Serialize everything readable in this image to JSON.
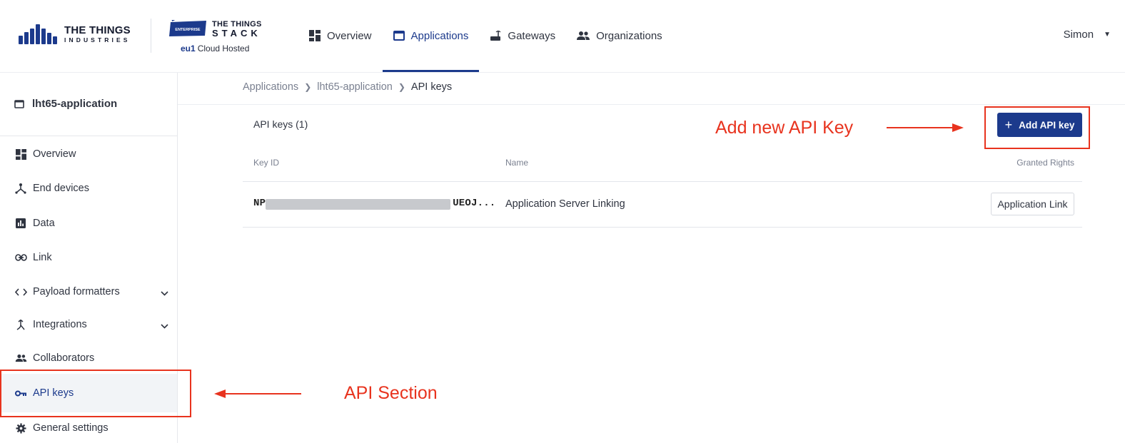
{
  "header": {
    "tti_logo": {
      "line1": "THE THINGS",
      "line2": "INDUSTRIES"
    },
    "tts_logo": {
      "badge": "ENTERPRISE",
      "line1": "THE THINGS",
      "line2": "STACK",
      "region": "eu1",
      "hosting": "Cloud Hosted"
    },
    "nav": [
      {
        "label": "Overview",
        "icon": "dashboard-icon",
        "active": false
      },
      {
        "label": "Applications",
        "icon": "application-icon",
        "active": true
      },
      {
        "label": "Gateways",
        "icon": "gateway-icon",
        "active": false
      },
      {
        "label": "Organizations",
        "icon": "people-icon",
        "active": false
      }
    ],
    "user": {
      "name": "Simon",
      "icon": "caret-down-icon"
    }
  },
  "sidebar": {
    "title": "lht65-application",
    "items": [
      {
        "label": "Overview",
        "icon": "dashboard-icon"
      },
      {
        "label": "End devices",
        "icon": "device-hub-icon"
      },
      {
        "label": "Data",
        "icon": "bar-chart-icon"
      },
      {
        "label": "Link",
        "icon": "link-icon"
      },
      {
        "label": "Payload formatters",
        "icon": "code-icon",
        "expandable": true
      },
      {
        "label": "Integrations",
        "icon": "merge-icon",
        "expandable": true
      },
      {
        "label": "Collaborators",
        "icon": "people-icon"
      },
      {
        "label": "API keys",
        "icon": "key-icon",
        "active": true
      },
      {
        "label": "General settings",
        "icon": "gear-icon"
      }
    ]
  },
  "breadcrumb": [
    "Applications",
    "lht65-application",
    "API keys"
  ],
  "api_keys": {
    "count_label": "API keys (1)",
    "add_button": "Add API key",
    "columns": {
      "key_id": "Key ID",
      "name": "Name",
      "rights": "Granted Rights"
    },
    "rows": [
      {
        "key_id": "NP…UEOJ...",
        "key_prefix": "NP",
        "key_suffix": "UEOJ...",
        "name": "Application Server Linking",
        "rights": "Application Link"
      }
    ]
  },
  "annotations": {
    "add_key": "Add new API Key",
    "api_section": "API Section",
    "color": "#e8331e"
  },
  "colors": {
    "accent": "#1c3a8c",
    "annotation": "#e8331e"
  }
}
